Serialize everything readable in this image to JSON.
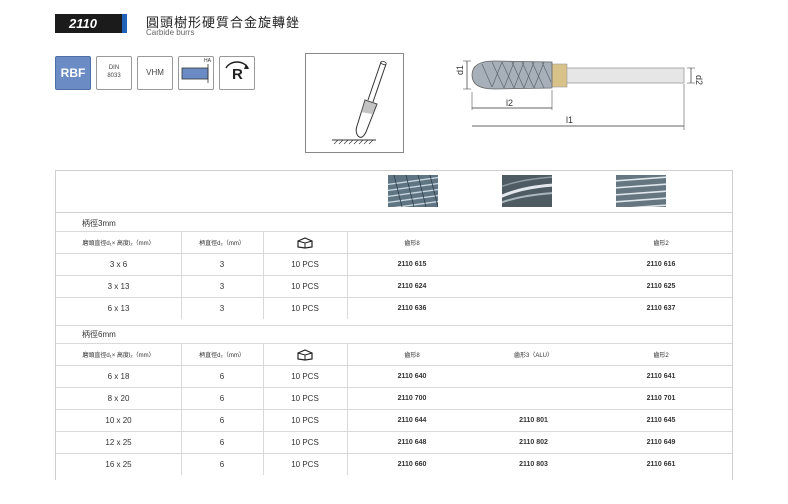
{
  "header": {
    "code": "2110",
    "title_zh": "圓頭樹形硬質合金旋轉銼",
    "title_en": "Carbide burrs"
  },
  "icons": {
    "rbf": "RBF",
    "din_line1": "DIN",
    "din_line2": "8033",
    "vhm": "VHM",
    "ha": "HA",
    "rotation": "R"
  },
  "diagram": {
    "d1": "d1",
    "d2": "d2",
    "l1": "l1",
    "l2": "l2"
  },
  "table": {
    "header_cols": {
      "dim": "磨頭直徑d₁× 高度l₂（mm）",
      "shank": "柄直徑d₂（mm）",
      "pack_icon": "package-icon"
    },
    "sections": [
      {
        "title": "柄徑3mm",
        "col4": "齒形8",
        "col5": "",
        "col6": "齒形2",
        "rows": [
          {
            "dim": "3 x 6",
            "shank": "3",
            "pack": "10 PCS",
            "a": "2110 615",
            "b": "",
            "c": "2110 616"
          },
          {
            "dim": "3 x 13",
            "shank": "3",
            "pack": "10 PCS",
            "a": "2110 624",
            "b": "",
            "c": "2110 625"
          },
          {
            "dim": "6 x 13",
            "shank": "3",
            "pack": "10 PCS",
            "a": "2110 636",
            "b": "",
            "c": "2110 637"
          }
        ]
      },
      {
        "title": "柄徑6mm",
        "col4": "齒形8",
        "col5": "齒形3（ALU）",
        "col6": "齒形2",
        "rows": [
          {
            "dim": "6 x 18",
            "shank": "6",
            "pack": "10 PCS",
            "a": "2110 640",
            "b": "",
            "c": "2110 641"
          },
          {
            "dim": "8 x 20",
            "shank": "6",
            "pack": "10 PCS",
            "a": "2110 700",
            "b": "",
            "c": "2110 701"
          },
          {
            "dim": "10 x 20",
            "shank": "6",
            "pack": "10 PCS",
            "a": "2110 644",
            "b": "2110 801",
            "c": "2110 645"
          },
          {
            "dim": "12 x 25",
            "shank": "6",
            "pack": "10 PCS",
            "a": "2110 648",
            "b": "2110 802",
            "c": "2110 649"
          },
          {
            "dim": "16 x 25",
            "shank": "6",
            "pack": "10 PCS",
            "a": "2110 660",
            "b": "2110 803",
            "c": "2110 661"
          }
        ]
      }
    ]
  }
}
